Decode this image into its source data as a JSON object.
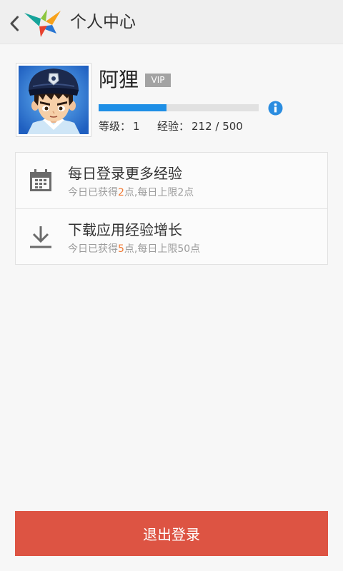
{
  "header": {
    "back_icon": "chevron-left-icon",
    "logo_icon": "app-logo-icon",
    "title": "个人中心"
  },
  "profile": {
    "name": "阿狸",
    "badge": "VIP",
    "exp_bar": {
      "value": 212,
      "max": 500
    },
    "info_icon": "info-icon",
    "level_label": "等级：",
    "level_value": "1",
    "exp_label": "经验：",
    "exp_text": "212 / 500"
  },
  "tasks": [
    {
      "icon": "calendar-icon",
      "title": "每日登录更多经验",
      "desc_before": "今日已获得",
      "desc_gained": "2",
      "desc_after": "点,每日上限2点"
    },
    {
      "icon": "download-icon",
      "title": "下载应用经验增长",
      "desc_before": "今日已获得",
      "desc_gained": "5",
      "desc_after": "点,每日上限50点"
    }
  ],
  "logout": {
    "label": "退出登录"
  },
  "colors": {
    "header_bg": "#efefef",
    "page_bg": "#f7f7f7",
    "accent_blue": "#1e8fe6",
    "info_blue": "#2b8de0",
    "badge_gray": "#a3a3a3",
    "highlight_orange": "#f07a35",
    "logout_red": "#dd5443"
  }
}
